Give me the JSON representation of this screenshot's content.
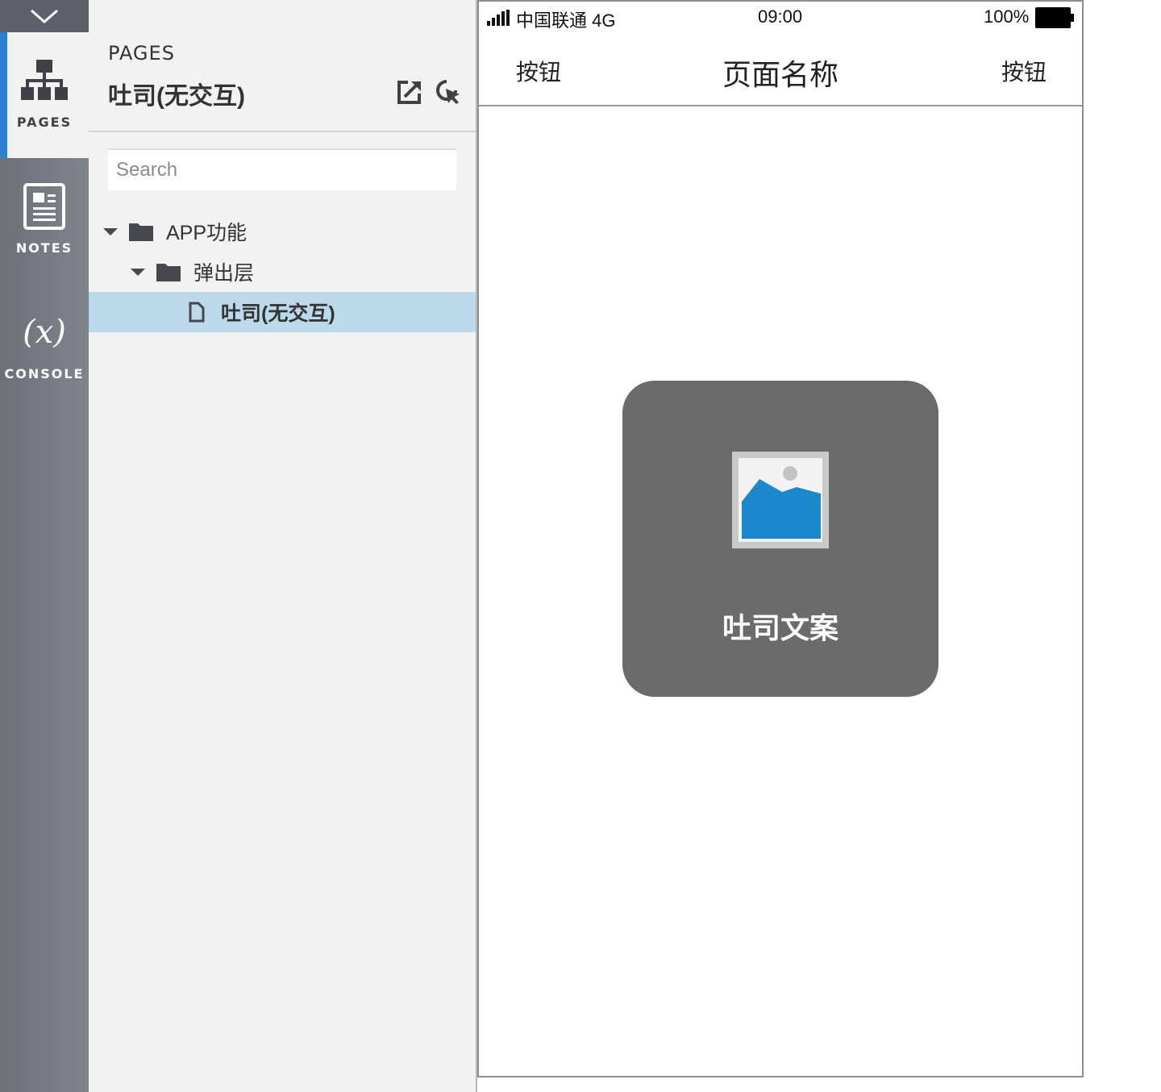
{
  "rail": {
    "tabs": [
      {
        "id": "pages",
        "label": "PAGES",
        "icon": "sitemap-icon",
        "active": true
      },
      {
        "id": "notes",
        "label": "NOTES",
        "icon": "notes-icon",
        "active": false
      },
      {
        "id": "console",
        "label": "CONSOLE",
        "icon": "variable-icon",
        "glyph": "(x)",
        "active": false
      }
    ],
    "accent": "#2d7fd1"
  },
  "panel": {
    "heading": "PAGES",
    "current_page": "吐司(无交互)",
    "search_placeholder": "Search",
    "tree": [
      {
        "label": "APP功能",
        "type": "folder",
        "expanded": true,
        "depth": 0
      },
      {
        "label": "弹出层",
        "type": "folder",
        "expanded": true,
        "depth": 1
      },
      {
        "label": "吐司(无交互)",
        "type": "page",
        "selected": true,
        "depth": 2
      }
    ],
    "selected_color": "#bcd9ec"
  },
  "phone": {
    "status": {
      "carrier": "中国联通 4G",
      "time": "09:00",
      "battery": "100%"
    },
    "nav": {
      "left_button": "按钮",
      "title": "页面名称",
      "right_button": "按钮"
    },
    "toast": {
      "text": "吐司文案",
      "background": "#6b6b6b",
      "image_icon": "image-placeholder-icon"
    }
  }
}
